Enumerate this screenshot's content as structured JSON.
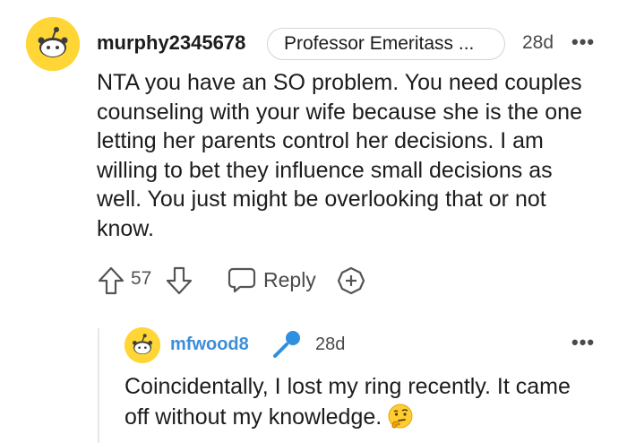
{
  "comment": {
    "username": "murphy2345678",
    "flair": "Professor Emeritass ...",
    "time": "28d",
    "more": "•••",
    "body": "NTA you have an SO problem. You need couples counseling with your wife because she is the one letting her parents control her decisions. I am willing to bet they influence small decisions as well. You just might be overlooking that or not know.",
    "votes": "57",
    "reply_label": "Reply"
  },
  "reply": {
    "username": "mfwood8",
    "time": "28d",
    "more": "•••",
    "body": "Coincidentally, I lost my ring recently. It came off without my knowledge.",
    "emoji": "thinking-face"
  },
  "icons": {
    "avatar": "snoo-avatar-icon",
    "upvote": "upvote-arrow-icon",
    "downvote": "downvote-arrow-icon",
    "reply": "speech-bubble-icon",
    "award": "award-plus-icon",
    "mic": "microphone-icon"
  },
  "colors": {
    "avatar_bg": "#ffd635",
    "reply_username": "#3d8ed9",
    "mic": "#2f8fe0"
  }
}
